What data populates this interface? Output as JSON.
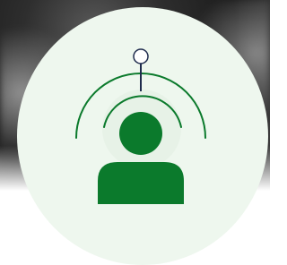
{
  "icon": {
    "name": "person-broadcast-icon",
    "description_name": "user-signal-icon"
  },
  "colors": {
    "circle_fill": "#eef7ee",
    "accent_green": "#0b7a2c",
    "stem_navy": "#1f2b4d",
    "backdrop_dark": "#2a2a2a",
    "backdrop_white": "#ffffff"
  }
}
